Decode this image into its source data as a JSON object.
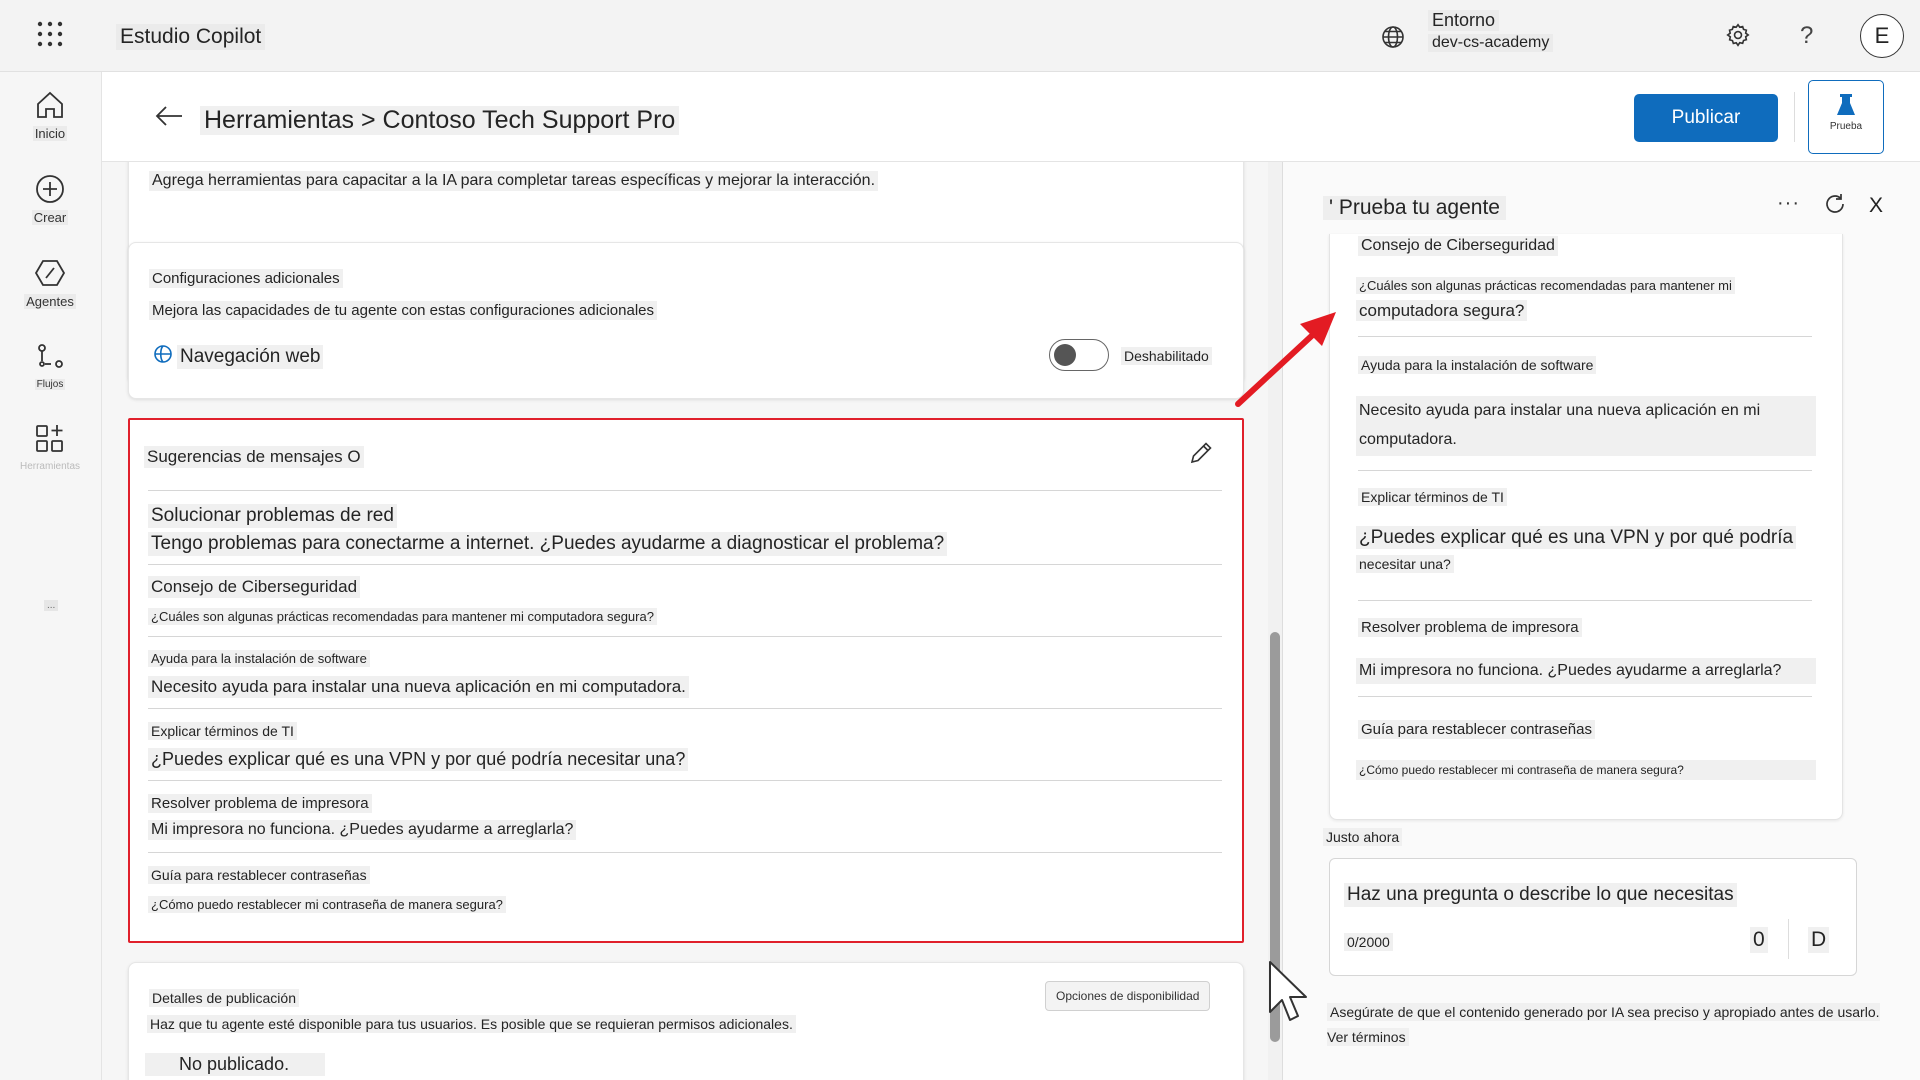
{
  "topbar": {
    "app_title": "Estudio Copilot",
    "environment_label": "Entorno",
    "environment_value": "dev-cs-academy",
    "help": "?",
    "avatar_initial": "E"
  },
  "rail": {
    "items": [
      {
        "label": "Inicio",
        "icon": "home-icon"
      },
      {
        "label": "Crear",
        "icon": "plus-circle-icon"
      },
      {
        "label": "Agentes",
        "icon": "agents-icon"
      },
      {
        "label": "Flujos",
        "icon": "flows-icon"
      },
      {
        "label": "Herramientas",
        "icon": "apps-icon"
      }
    ],
    "more": "..."
  },
  "header": {
    "breadcrumb": "Herramientas > Contoso Tech Support Pro",
    "publish_label": "Publicar",
    "test_label": "Prueba"
  },
  "tools_card": {
    "description": "Agrega herramientas para capacitar a la IA para completar tareas específicas y mejorar la interacción."
  },
  "config_card": {
    "title": "Configuraciones adicionales",
    "description": "Mejora las capacidades de tu agente con estas configuraciones adicionales",
    "web_label": "Navegación web",
    "toggle_state": "Deshabilitado"
  },
  "suggestions_card": {
    "title": "Sugerencias de mensajes O",
    "items": [
      {
        "title": "Solucionar problemas de red",
        "text": "Tengo problemas para conectarme a internet. ¿Puedes ayudarme a diagnosticar el problema?"
      },
      {
        "title": "Consejo de Ciberseguridad",
        "text": "¿Cuáles son algunas prácticas recomendadas para mantener mi computadora segura?"
      },
      {
        "title": "Ayuda para la instalación de software",
        "text": "Necesito ayuda para instalar una nueva aplicación en mi computadora."
      },
      {
        "title": "Explicar términos de TI",
        "text": "¿Puedes explicar qué es una VPN y por qué podría necesitar una?"
      },
      {
        "title": "Resolver problema de impresora",
        "text": "Mi impresora no funciona. ¿Puedes ayudarme a arreglarla?"
      },
      {
        "title": "Guía para restablecer contraseñas",
        "text": "¿Cómo puedo restablecer mi contraseña de manera segura?"
      }
    ]
  },
  "publish_card": {
    "title": "Detalles de publicación",
    "description": "Haz que tu agente esté disponible para tus usuarios. Es posible que se requieran permisos adicionales.",
    "availability_button": "Opciones de disponibilidad",
    "status": "No publicado."
  },
  "test_panel": {
    "title": "' Prueba tu agente",
    "more": "···",
    "close": "X",
    "items": [
      {
        "title": "Consejo de Ciberseguridad",
        "text_a": "¿Cuáles son algunas prácticas recomendadas para mantener mi",
        "text_b": "computadora segura?"
      },
      {
        "title": "Ayuda para la instalación de software",
        "text": "Necesito ayuda para instalar una nueva aplicación en mi computadora."
      },
      {
        "title": "Explicar términos de TI",
        "text_a": "¿Puedes explicar qué es una VPN y por qué podría",
        "text_b": "necesitar una?"
      },
      {
        "title": "Resolver problema de impresora",
        "text": "Mi impresora no funciona. ¿Puedes ayudarme a arreglarla?"
      },
      {
        "title": "Guía para restablecer contraseñas",
        "text": "¿Cómo puedo restablecer mi contraseña de manera segura?"
      }
    ],
    "timestamp": "Justo ahora",
    "input_placeholder": "Haz una pregunta o describe lo que necesitas",
    "char_count": "0/2000",
    "attach_glyph": "0",
    "send_glyph": "D",
    "disclaimer": "Asegúrate de que el contenido generado por IA sea preciso y apropiado antes de usarlo. Ver términos"
  },
  "colors": {
    "accent": "#0f6cbd",
    "highlight_border": "#e0202b",
    "arrow": "#e31b23"
  }
}
